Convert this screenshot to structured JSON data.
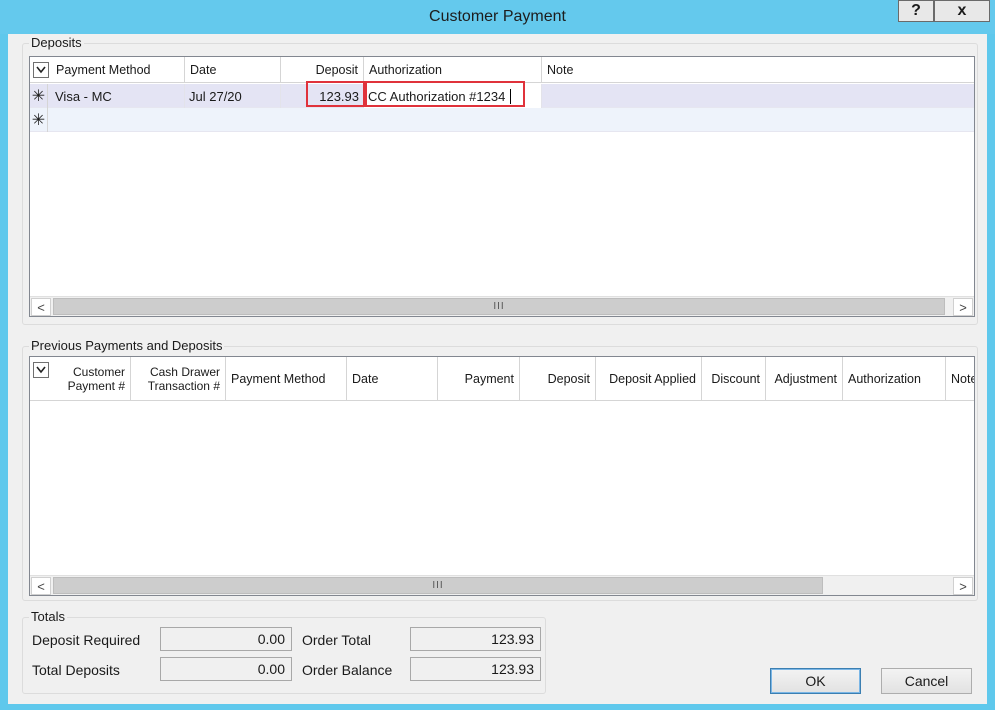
{
  "window": {
    "title": "Customer Payment",
    "help_label": "?",
    "close_label": "x"
  },
  "deposits": {
    "group_label": "Deposits",
    "columns": [
      "Payment Method",
      "Date",
      "Deposit",
      "Authorization",
      "Note"
    ],
    "rows": [
      {
        "payment_method": "Visa - MC",
        "date": "Jul 27/20",
        "deposit": "123.93",
        "authorization": "CC Authorization #1234",
        "note": ""
      }
    ],
    "scroll_thumb_glyph": "III",
    "scroll_left": "<",
    "scroll_right": ">"
  },
  "previous": {
    "group_label": "Previous Payments and Deposits",
    "columns": {
      "customer_payment": [
        "Customer",
        "Payment #"
      ],
      "cash_drawer": [
        "Cash Drawer",
        "Transaction #"
      ],
      "payment_method": "Payment Method",
      "date": "Date",
      "payment": "Payment",
      "deposit": "Deposit",
      "deposit_applied": "Deposit Applied",
      "discount": "Discount",
      "adjustment": "Adjustment",
      "authorization": "Authorization",
      "note": "Note"
    },
    "scroll_thumb_glyph": "III",
    "scroll_left": "<",
    "scroll_right": ">"
  },
  "totals": {
    "group_label": "Totals",
    "deposit_required_label": "Deposit Required",
    "deposit_required_value": "0.00",
    "total_deposits_label": "Total Deposits",
    "total_deposits_value": "0.00",
    "order_total_label": "Order Total",
    "order_total_value": "123.93",
    "order_balance_label": "Order Balance",
    "order_balance_value": "123.93"
  },
  "buttons": {
    "ok_label": "OK",
    "cancel_label": "Cancel"
  },
  "colors": {
    "titlebar": "#64c9ed",
    "highlight": "#e0323b",
    "selected_row": "#e4e4f4",
    "new_row": "#eef3fb"
  },
  "icons": {
    "row_indicator": "asterisk-icon",
    "column_chooser": "chevron-down-icon"
  }
}
